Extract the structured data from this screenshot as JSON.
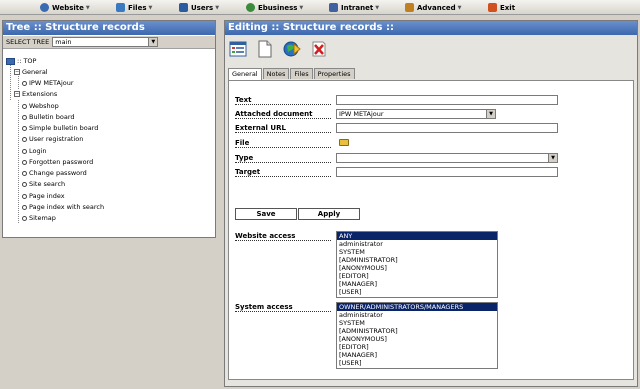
{
  "menu": [
    {
      "label": "Website",
      "icon": "globe-icon",
      "color": "#3a6ab0"
    },
    {
      "label": "Files",
      "icon": "files-icon",
      "color": "#3a7ac0"
    },
    {
      "label": "Users",
      "icon": "users-icon",
      "color": "#2a5aa0"
    },
    {
      "label": "Ebusiness",
      "icon": "ebusiness-icon",
      "color": "#3c8a3c"
    },
    {
      "label": "Intranet",
      "icon": "intranet-icon",
      "color": "#4060a0"
    },
    {
      "label": "Advanced",
      "icon": "advanced-icon",
      "color": "#c08020"
    },
    {
      "label": "Exit",
      "icon": "exit-icon",
      "color": "#d05020"
    }
  ],
  "tree_panel": {
    "title": "Tree :: Structure records",
    "select_label": "SELECT TREE",
    "select_value": "main",
    "nodes": [
      {
        "label": ":: TOP"
      },
      {
        "label": "General"
      },
      {
        "label": "IPW METAjour"
      },
      {
        "label": "Extensions"
      },
      {
        "label": "Webshop"
      },
      {
        "label": "Bulletin board"
      },
      {
        "label": "Simple bulletin board"
      },
      {
        "label": "User registration"
      },
      {
        "label": "Login"
      },
      {
        "label": "Forgotten password"
      },
      {
        "label": "Change password"
      },
      {
        "label": "Site search"
      },
      {
        "label": "Page index"
      },
      {
        "label": "Page index with search"
      },
      {
        "label": "Sitemap"
      }
    ]
  },
  "edit_panel": {
    "title": "Editing :: Structure records ::",
    "toolbar": [
      "properties-icon",
      "new-document-icon",
      "publish-icon",
      "delete-icon"
    ],
    "tabs": [
      "General",
      "Notes",
      "Files",
      "Properties"
    ],
    "fields": {
      "text": {
        "label": "Text",
        "value": ""
      },
      "attached_document": {
        "label": "Attached document",
        "value": "IPW METAjour"
      },
      "external_url": {
        "label": "External URL",
        "value": ""
      },
      "file": {
        "label": "File"
      },
      "type": {
        "label": "Type",
        "value": ""
      },
      "target": {
        "label": "Target",
        "value": ""
      }
    },
    "save_label": "Save",
    "apply_label": "Apply",
    "website_access": {
      "label": "Website access",
      "options": [
        "ANY",
        "administrator",
        "SYSTEM",
        "[ADMINISTRATOR]",
        "[ANONYMOUS]",
        "[EDITOR]",
        "[MANAGER]",
        "[USER]"
      ],
      "selected": "ANY"
    },
    "system_access": {
      "label": "System access",
      "options": [
        "OWNER/ADMINISTRATORS/MANAGERS",
        "administrator",
        "SYSTEM",
        "[ADMINISTRATOR]",
        "[ANONYMOUS]",
        "[EDITOR]",
        "[MANAGER]",
        "[USER]"
      ],
      "selected": "OWNER/ADMINISTRATORS/MANAGERS"
    }
  }
}
